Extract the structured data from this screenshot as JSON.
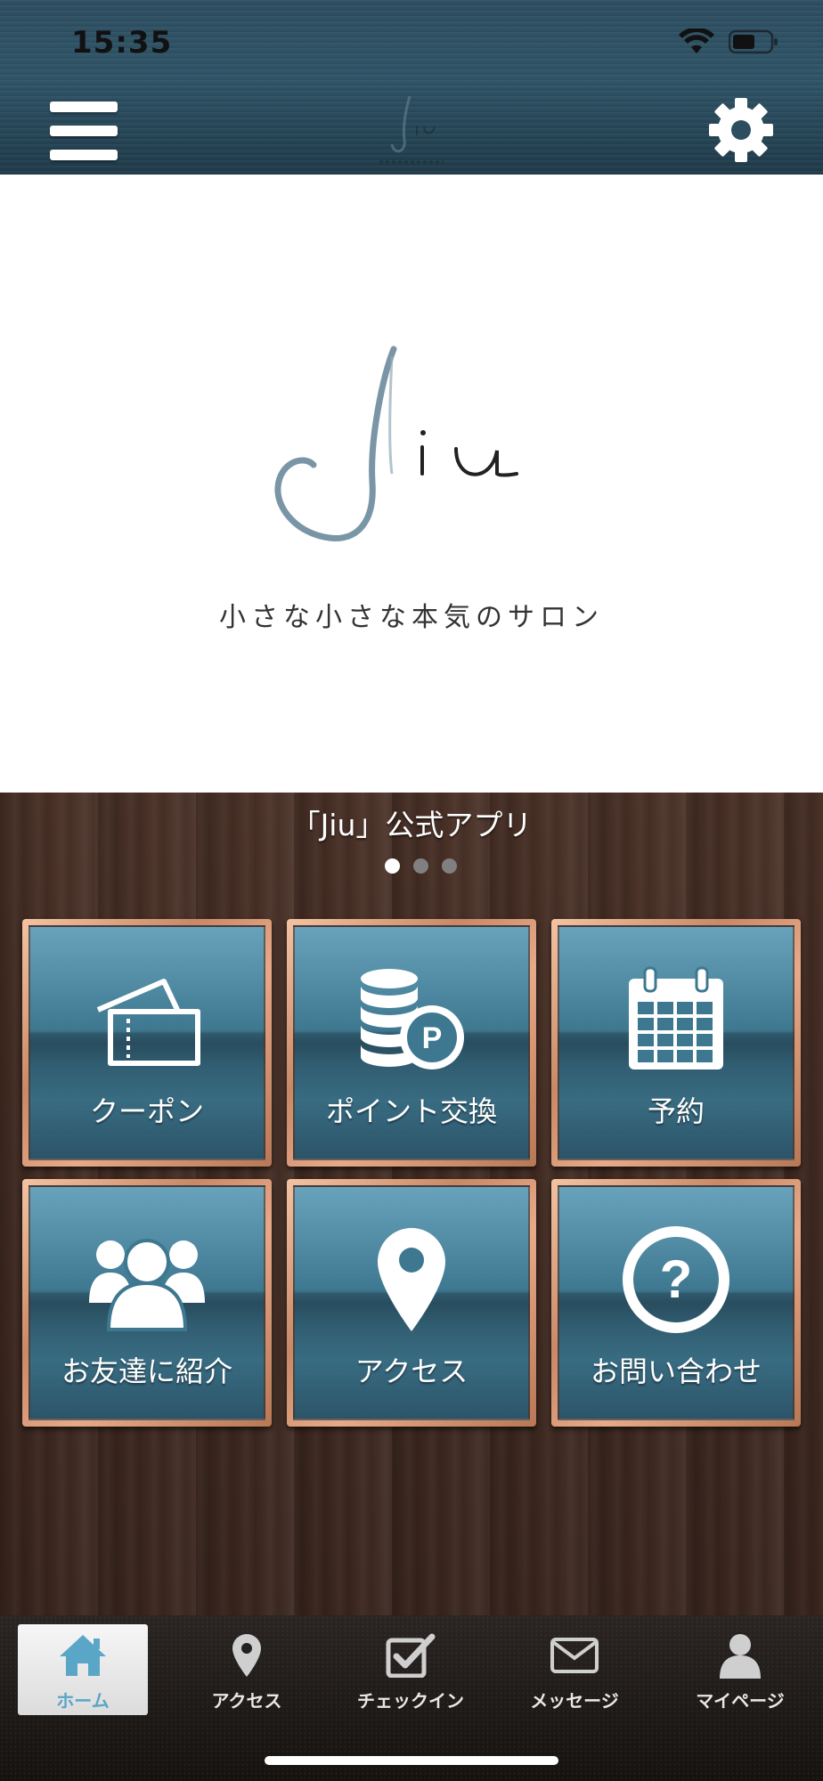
{
  "status_bar": {
    "time": "15:35"
  },
  "header": {
    "menu_icon": "hamburger-icon",
    "settings_icon": "gear-icon"
  },
  "hero": {
    "logo_text": "Jiu",
    "tagline": "小さな小さな本気のサロン"
  },
  "main": {
    "app_title": "「Jiu」公式アプリ",
    "pager": {
      "count": 3,
      "active_index": 0
    },
    "tiles": [
      {
        "label": "クーポン",
        "icon": "coupon-ticket-icon"
      },
      {
        "label": "ポイント交換",
        "icon": "points-coins-icon"
      },
      {
        "label": "予約",
        "icon": "calendar-icon"
      },
      {
        "label": "お友達に紹介",
        "icon": "friends-group-icon"
      },
      {
        "label": "アクセス",
        "icon": "map-pin-icon"
      },
      {
        "label": "お問い合わせ",
        "icon": "question-circle-icon"
      }
    ]
  },
  "tabbar": {
    "tabs": [
      {
        "label": "ホーム",
        "icon": "home-icon",
        "active": true
      },
      {
        "label": "アクセス",
        "icon": "map-pin-icon",
        "active": false
      },
      {
        "label": "チェックイン",
        "icon": "checkin-checkbox-icon",
        "active": false
      },
      {
        "label": "メッセージ",
        "icon": "envelope-icon",
        "active": false
      },
      {
        "label": "マイページ",
        "icon": "user-icon",
        "active": false
      }
    ]
  },
  "colors": {
    "accent": "#5aa6c6",
    "tile_blue": "#3e7890",
    "header_blue": "#2f5467",
    "wood": "#3a261e"
  }
}
